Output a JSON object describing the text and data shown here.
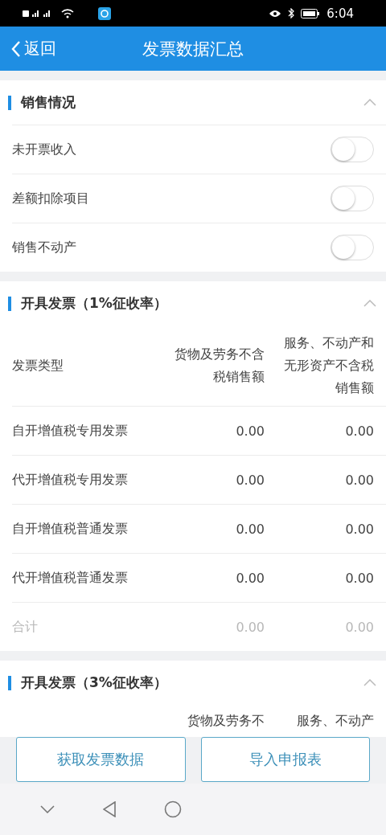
{
  "status_bar": {
    "time": "6:04"
  },
  "header": {
    "back": "返回",
    "title": "发票数据汇总"
  },
  "sections": [
    {
      "kind": "toggles",
      "title": "销售情况",
      "expanded": true,
      "items": [
        {
          "label": "未开票收入",
          "on": false
        },
        {
          "label": "差额扣除项目",
          "on": false
        },
        {
          "label": "销售不动产",
          "on": false
        }
      ]
    },
    {
      "kind": "table",
      "title": "开具发票（1%征收率）",
      "expanded": true,
      "columns": [
        "发票类型",
        "货物及劳务不含税销售额",
        "服务、不动产和无形资产不含税销售额"
      ],
      "rows": [
        {
          "cells": [
            "自开增值税专用发票",
            "0.00",
            "0.00"
          ],
          "disabled": false
        },
        {
          "cells": [
            "代开增值税专用发票",
            "0.00",
            "0.00"
          ],
          "disabled": false
        },
        {
          "cells": [
            "自开增值税普通发票",
            "0.00",
            "0.00"
          ],
          "disabled": false
        },
        {
          "cells": [
            "代开增值税普通发票",
            "0.00",
            "0.00"
          ],
          "disabled": false
        },
        {
          "cells": [
            "合计",
            "0.00",
            "0.00"
          ],
          "disabled": true
        }
      ]
    },
    {
      "kind": "table",
      "title": "开具发票（3%征收率）",
      "expanded": true,
      "columns": [
        "",
        "货物及劳务不",
        "服务、不动产"
      ]
    }
  ],
  "buttons": [
    "获取发票数据",
    "导入申报表"
  ]
}
